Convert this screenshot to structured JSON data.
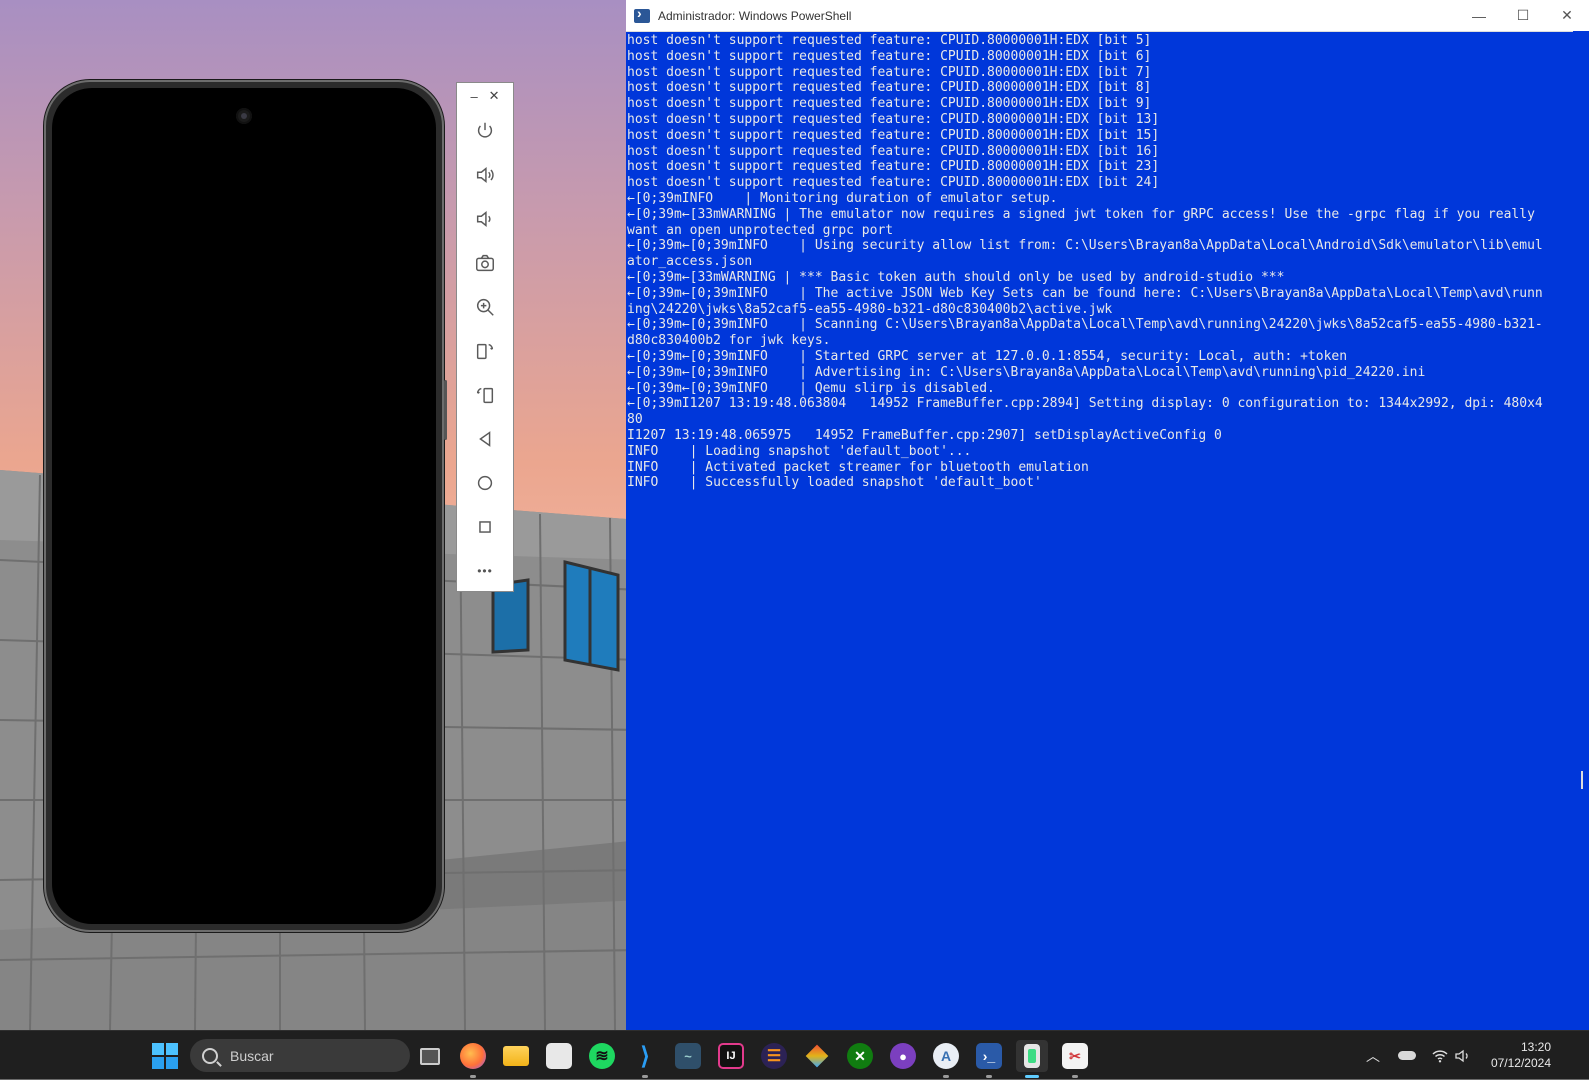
{
  "powershell": {
    "title": "Administrador: Windows PowerShell",
    "controls": {
      "minimize": "—",
      "maximize": "☐",
      "close": "✕"
    },
    "lines": [
      "host doesn't support requested feature: CPUID.80000001H:EDX [bit 5]",
      "host doesn't support requested feature: CPUID.80000001H:EDX [bit 6]",
      "host doesn't support requested feature: CPUID.80000001H:EDX [bit 7]",
      "host doesn't support requested feature: CPUID.80000001H:EDX [bit 8]",
      "host doesn't support requested feature: CPUID.80000001H:EDX [bit 9]",
      "host doesn't support requested feature: CPUID.80000001H:EDX [bit 13]",
      "host doesn't support requested feature: CPUID.80000001H:EDX [bit 15]",
      "host doesn't support requested feature: CPUID.80000001H:EDX [bit 16]",
      "host doesn't support requested feature: CPUID.80000001H:EDX [bit 23]",
      "host doesn't support requested feature: CPUID.80000001H:EDX [bit 24]",
      "←[0;39mINFO    | Monitoring duration of emulator setup.",
      "←[0;39m←[33mWARNING | The emulator now requires a signed jwt token for gRPC access! Use the -grpc flag if you really",
      "want an open unprotected grpc port",
      "←[0;39m←[0;39mINFO    | Using security allow list from: C:\\Users\\Brayan8a\\AppData\\Local\\Android\\Sdk\\emulator\\lib\\emul",
      "ator_access.json",
      "←[0;39m←[33mWARNING | *** Basic token auth should only be used by android-studio ***",
      "←[0;39m←[0;39mINFO    | The active JSON Web Key Sets can be found here: C:\\Users\\Brayan8a\\AppData\\Local\\Temp\\avd\\runn",
      "ing\\24220\\jwks\\8a52caf5-ea55-4980-b321-d80c830400b2\\active.jwk",
      "←[0;39m←[0;39mINFO    | Scanning C:\\Users\\Brayan8a\\AppData\\Local\\Temp\\avd\\running\\24220\\jwks\\8a52caf5-ea55-4980-b321-",
      "d80c830400b2 for jwk keys.",
      "←[0;39m←[0;39mINFO    | Started GRPC server at 127.0.0.1:8554, security: Local, auth: +token",
      "←[0;39m←[0;39mINFO    | Advertising in: C:\\Users\\Brayan8a\\AppData\\Local\\Temp\\avd\\running\\pid_24220.ini",
      "←[0;39m←[0;39mINFO    | Qemu slirp is disabled.",
      "←[0;39mI1207 13:19:48.063804   14952 FrameBuffer.cpp:2894] Setting display: 0 configuration to: 1344x2992, dpi: 480x4",
      "80",
      "I1207 13:19:48.065975   14952 FrameBuffer.cpp:2907] setDisplayActiveConfig 0",
      "INFO    | Loading snapshot 'default_boot'...",
      "INFO    | Activated packet streamer for bluetooth emulation",
      "INFO    | Successfully loaded snapshot 'default_boot'"
    ]
  },
  "emulator_toolbar": {
    "minimize": "–",
    "close": "✕",
    "buttons": [
      "power-icon",
      "volume-up-icon",
      "volume-down-icon",
      "camera-icon",
      "zoom-icon",
      "rotate-left-icon",
      "rotate-right-icon",
      "back-icon",
      "home-icon",
      "overview-icon",
      "more-icon"
    ],
    "more_label": "•••"
  },
  "taskbar": {
    "search_placeholder": "Buscar",
    "apps": [
      "task-view-icon",
      "firefox-icon",
      "file-explorer-icon",
      "microsoft-store-icon",
      "spotify-icon",
      "vscode-icon",
      "mysql-workbench-icon",
      "intellij-icon",
      "eclipse-icon",
      "git-icon",
      "xbox-icon",
      "github-desktop-icon",
      "android-studio-icon",
      "powershell-icon",
      "emulator-icon",
      "snipping-tool-icon"
    ],
    "clock_time": "13:20",
    "clock_date": "07/12/2024"
  },
  "colors": {
    "powershell_bg": "#0037da",
    "taskbar_bg": "#1f1f1f",
    "accent": "#60cdff"
  }
}
